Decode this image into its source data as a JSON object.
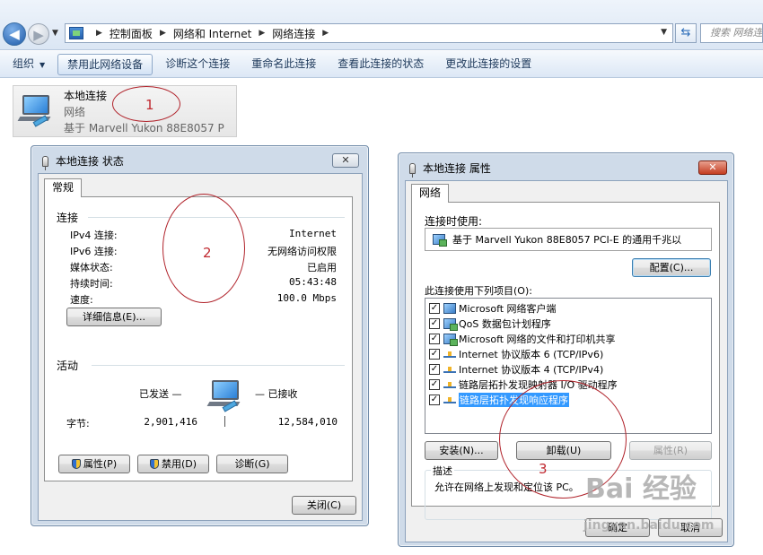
{
  "explorer": {
    "breadcrumb": [
      "控制面板",
      "网络和 Internet",
      "网络连接"
    ],
    "search_placeholder": "搜索 网络连",
    "commands": [
      {
        "label": "组织",
        "has_dropdown": true
      },
      {
        "label": "禁用此网络设备",
        "active": true
      },
      {
        "label": "诊断这个连接"
      },
      {
        "label": "重命名此连接"
      },
      {
        "label": "查看此连接的状态"
      },
      {
        "label": "更改此连接的设置"
      }
    ],
    "connection": {
      "name": "本地连接",
      "network": "网络",
      "adapter": "基于 Marvell Yukon 88E8057 P"
    }
  },
  "status_dialog": {
    "title": "本地连接 状态",
    "close_x": "✕",
    "tab": "常规",
    "connection_group": "连接",
    "rows": [
      {
        "key": "IPv4 连接:",
        "value": "Internet"
      },
      {
        "key": "IPv6 连接:",
        "value": "无网络访问权限"
      },
      {
        "key": "媒体状态:",
        "value": "已启用"
      },
      {
        "key": "持续时间:",
        "value": "05:43:48"
      },
      {
        "key": "速度:",
        "value": "100.0 Mbps"
      }
    ],
    "details_button": "详细信息(E)...",
    "activity_group": "活动",
    "sent_label": "已发送 —",
    "received_label": "— 已接收",
    "bytes_label": "字节:",
    "bytes_sent": "2,901,416",
    "bytes_received": "12,584,010",
    "properties_button": "属性(P)",
    "disable_button": "禁用(D)",
    "diagnose_button": "诊断(G)",
    "close_button": "关闭(C)"
  },
  "properties_dialog": {
    "title": "本地连接 属性",
    "close_x": "✕",
    "tab": "网络",
    "connect_using_label": "连接时使用:",
    "adapter_name": "基于 Marvell Yukon 88E8057 PCI-E 的通用千兆以",
    "configure_button": "配置(C)...",
    "items_label": "此连接使用下列项目(O):",
    "items": [
      {
        "label": "Microsoft 网络客户端",
        "icon": "client-icon",
        "checked": true
      },
      {
        "label": "QoS 数据包计划程序",
        "icon": "service-icon",
        "checked": true
      },
      {
        "label": "Microsoft 网络的文件和打印机共享",
        "icon": "service-icon",
        "checked": true
      },
      {
        "label": "Internet 协议版本 6 (TCP/IPv6)",
        "icon": "protocol-icon",
        "checked": true
      },
      {
        "label": "Internet 协议版本 4 (TCP/IPv4)",
        "icon": "protocol-icon",
        "checked": true
      },
      {
        "label": "链路层拓扑发现映射器 I/O 驱动程序",
        "icon": "protocol-icon",
        "checked": true
      },
      {
        "label": "链路层拓扑发现响应程序",
        "icon": "protocol-icon",
        "checked": true,
        "selected": true
      }
    ],
    "install_button": "安装(N)...",
    "uninstall_button": "卸载(U)",
    "properties_button": "属性(R)",
    "description_label": "描述",
    "description_text": "允许在网络上发现和定位该 PC。",
    "ok_button": "确定",
    "cancel_button": "取消"
  },
  "annotations": [
    "1",
    "2",
    "3"
  ],
  "watermark": {
    "main": "Bai 经验",
    "sub": "jingyan.baidu.com"
  },
  "colors": {
    "accent": "#3399ff",
    "annotation": "#c0282f",
    "window_frame": "#cfdbe9"
  }
}
